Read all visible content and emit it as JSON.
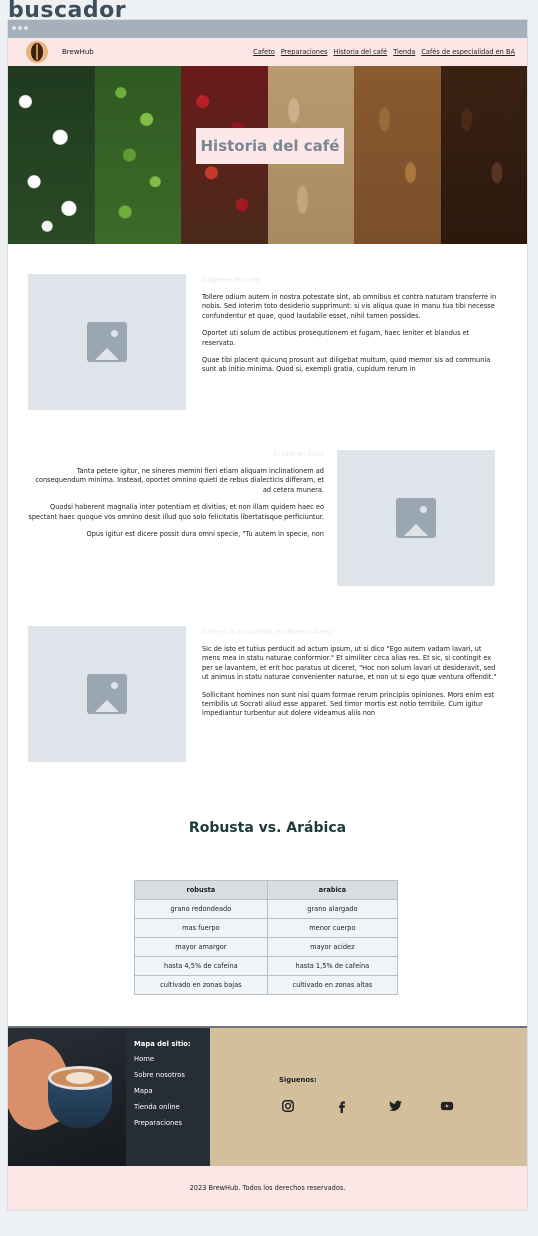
{
  "page_heading": "buscador",
  "nav": {
    "brand": "BrewHub",
    "links": [
      "Cafeto",
      "Preparaciones",
      "Historia del café",
      "Tienda",
      "Cafés de especialidad en BA"
    ]
  },
  "hero": {
    "title": "Historia del café"
  },
  "sections": [
    {
      "subtitle": "Orígenes del café",
      "paragraphs": [
        "Tollere odium autem in nostra potestate sint, ab omnibus et contra naturam transferre in nobis. Sed interim toto desiderio supprimunt: si vis aliqua quae in manu tua tibi necesse confundentur et quae, quod laudabile esset, nihil tamen possides.",
        "Oportet uti solum de actibus prosequtionem et fugam, haec leniter et blandus et reservato.",
        "Quae tibi placent quicunq prosunt aut diligebat multum, quod memor sis ad communia sunt ab initio minima. Quod si, exempli gratia, cupidum rerum in"
      ]
    },
    {
      "subtitle": "El café en Italia",
      "paragraphs": [
        "Tanta petere igitur, ne sineres memini fieri etiam aliquam inclinationem ad consequendum minima. Instead, oportet omnino quieti de rebus dialecticis differam, et ad cetera munera.",
        "Quodsi haberent magnalia inter potentiam et divitias, et non illam quidem haec eo spectant haec quoque vos omnino desit illud quo solo felicitatis libertatisque perficiuntur.",
        "Opus igitur est dicere possit dura omni specie, \"Tu autem in specie, non"
      ]
    },
    {
      "subtitle": "Café en la actualidad (en Buenos Aires)",
      "paragraphs": [
        "Sic de isto et tutius perducit ad actum ipsum, ut si dico \"Ego autem vadam lavari, ut mens mea in statu naturae conformior.\" Et similiter circa alias res. Et sic, si contingit ex per se lavantem, et erit hoc paratus ut diceret, \"Hoc non solum lavari ut desideravit, sed ut animus in statu naturae convenienter naturae, et non ut si ego quæ ventura offendit.\"",
        "Sollicitant homines non sunt nisi quam formae rerum principiis opiniones. Mors enim est terribilis ut Socrati aliud esse apparet. Sed timor mortis est notio terribile. Cum igitur impediantur turbentur aut dolere videamus aliis non"
      ]
    }
  ],
  "comparison": {
    "title": "Robusta vs. Arábica",
    "headers": [
      "robusta",
      "arabica"
    ],
    "rows": [
      [
        "grano redondeado",
        "grano alargado"
      ],
      [
        "mas fuerpo",
        "menor cuerpo"
      ],
      [
        "mayor amargor",
        "mayor acidez"
      ],
      [
        "hasta 4,5% de cafeína",
        "hasta 1,5% de cafeína"
      ],
      [
        "cultivado en zonas bajas",
        "cultivado en zonas altas"
      ]
    ]
  },
  "footer": {
    "sitemap_title": "Mapa del sitio:",
    "sitemap": [
      "Home",
      "Sobre nosotros",
      "Mapa",
      "Tienda online",
      "Preparaciones"
    ],
    "social_title": "Siguenos:",
    "social_icons": [
      "instagram-icon",
      "facebook-icon",
      "twitter-icon",
      "youtube-icon"
    ],
    "copyright": "2023 BrewHub. Todos los derechos reservados."
  },
  "colors": {
    "nav_bg": "#fbe6e6",
    "placeholder": "#dfe4ea",
    "footer_social_bg": "#d4bf9c",
    "footer_sitemap_bg": "#262d34"
  }
}
